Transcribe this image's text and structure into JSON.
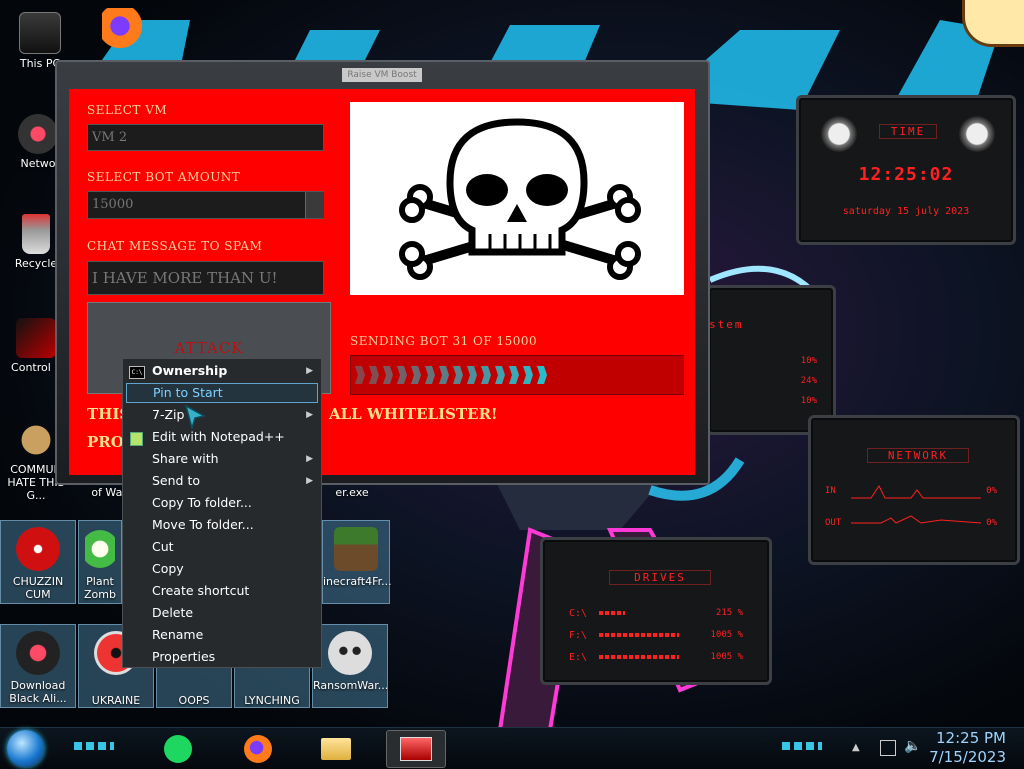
{
  "app": {
    "title": "Raise VM Boost",
    "select_vm_label": "SELECT VM",
    "select_vm_value": "VM 2",
    "bot_amount_label": "SELECT BOT AMOUNT",
    "bot_amount_value": "15000",
    "chat_label": "CHAT MESSAGE TO SPAM",
    "chat_value": "I HAVE MORE THAN U!",
    "attack_label": "ATTACK",
    "status_text": "SENDING BOT 31 OF 15000",
    "progress_fraction": 0.6,
    "bottom_line1_left": "THIS",
    "bottom_line1_right": "ALL WHITELISTER!",
    "bottom_line2_left": "PRO"
  },
  "context_menu": {
    "items": [
      {
        "label": "Ownership",
        "submenu": true
      },
      {
        "label": "Pin to Start",
        "submenu": false
      },
      {
        "label": "7-Zip",
        "submenu": true
      },
      {
        "label": "Edit with Notepad++",
        "submenu": false
      },
      {
        "label": "Share with",
        "submenu": true
      },
      {
        "label": "Send to",
        "submenu": true
      },
      {
        "label": "Copy To folder...",
        "submenu": false
      },
      {
        "label": "Move To folder...",
        "submenu": false
      },
      {
        "label": "Cut",
        "submenu": false
      },
      {
        "label": "Copy",
        "submenu": false
      },
      {
        "label": "Create shortcut",
        "submenu": false
      },
      {
        "label": "Delete",
        "submenu": false
      },
      {
        "label": "Rename",
        "submenu": false
      },
      {
        "label": "Properties",
        "submenu": false
      }
    ]
  },
  "desktop": {
    "icons": [
      {
        "label": "This PC"
      },
      {
        "label": "Netwo"
      },
      {
        "label": "Recycle"
      },
      {
        "label": "Control P"
      },
      {
        "label": "COMMUN HATE THIS G..."
      }
    ],
    "tiles_row1": [
      {
        "label": "CHUZZIN CUM"
      },
      {
        "label": "Plant Zomb"
      },
      {
        "label": "inecraft4Fr..."
      }
    ],
    "tiles_row2": [
      {
        "label": "Download Black Ali..."
      },
      {
        "label": "UKRAINE"
      },
      {
        "label": "OOPS"
      },
      {
        "label": "LYNCHING"
      },
      {
        "label": "RansomWar..."
      }
    ],
    "stray_labels": {
      "warc": "of Warc",
      "exe": "er.exe"
    }
  },
  "gadgets": {
    "time": {
      "title": "TIME",
      "clock": "12:25:02",
      "date": "saturday 15 july 2023"
    },
    "system": {
      "title": "stem",
      "values": [
        "10%",
        "24%",
        "10%"
      ]
    },
    "network": {
      "title": "NETWORK",
      "in_label": "IN",
      "out_label": "OUT",
      "in_value": "0%",
      "out_value": "0%"
    },
    "drives": {
      "title": "DRIVES",
      "rows": [
        {
          "label": "C:\\",
          "value": "215 %"
        },
        {
          "label": "F:\\",
          "value": "1005 %"
        },
        {
          "label": "E:\\",
          "value": "1005 %"
        }
      ]
    }
  },
  "taskbar": {
    "time": "12:25 PM",
    "date": "7/15/2023"
  },
  "colors": {
    "app_body": "#ff0000",
    "gadget_text": "#ff2020",
    "progress_seg": "#22c6d6"
  }
}
